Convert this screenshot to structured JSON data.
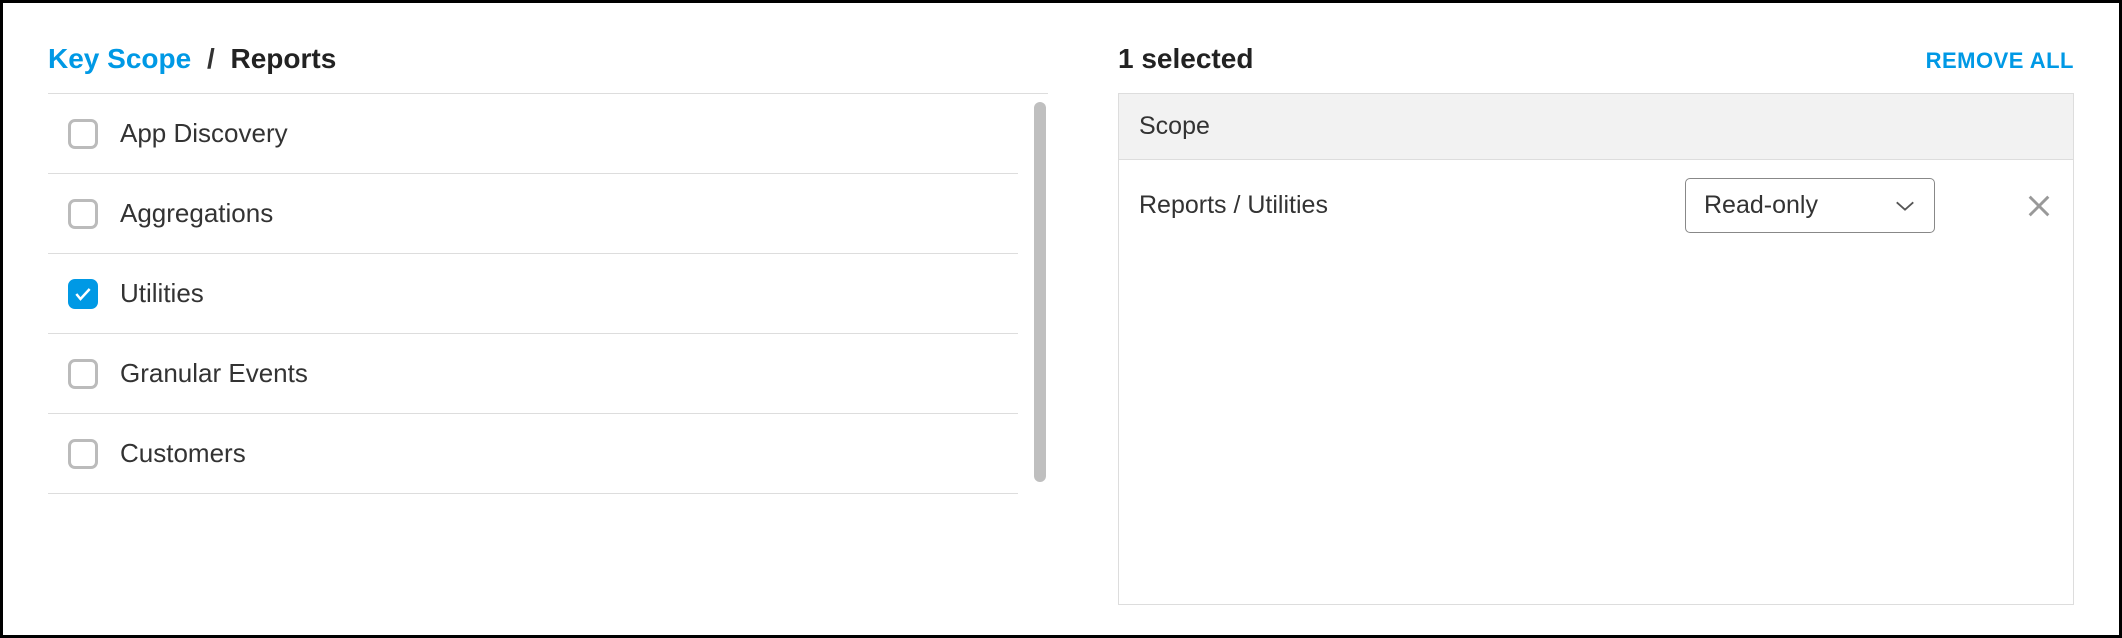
{
  "breadcrumb": {
    "root": "Key Scope",
    "separator": "/",
    "current": "Reports"
  },
  "scope_items": [
    {
      "label": "App Discovery",
      "checked": false
    },
    {
      "label": "Aggregations",
      "checked": false
    },
    {
      "label": "Utilities",
      "checked": true
    },
    {
      "label": "Granular Events",
      "checked": false
    },
    {
      "label": "Customers",
      "checked": false
    }
  ],
  "selection": {
    "count_text": "1 selected",
    "remove_all_label": "REMOVE ALL",
    "header_label": "Scope",
    "rows": [
      {
        "path": "Reports / Utilities",
        "permission": "Read-only"
      }
    ]
  }
}
